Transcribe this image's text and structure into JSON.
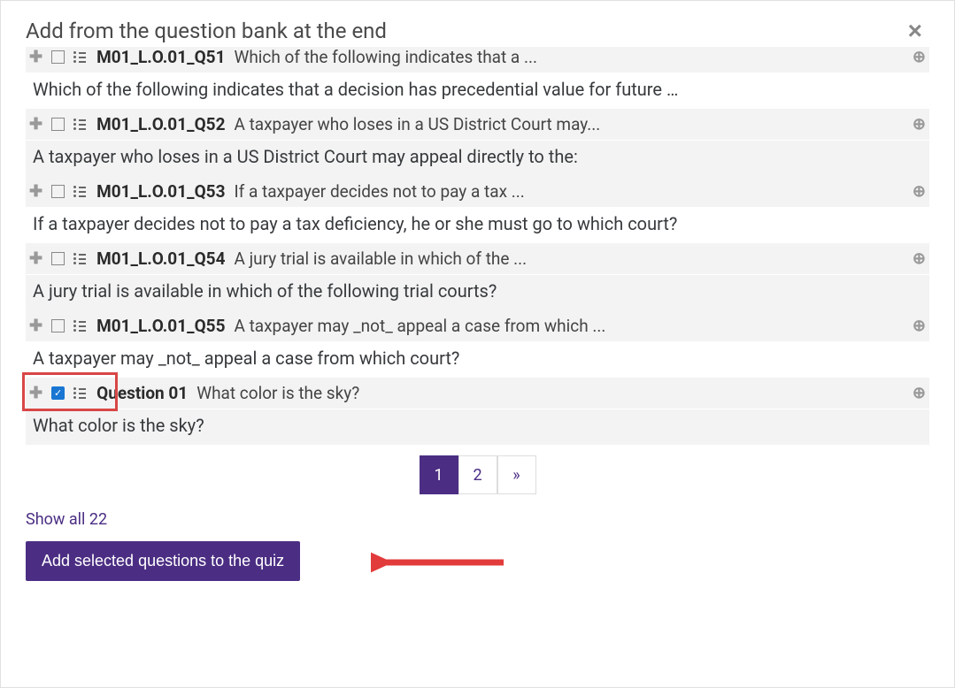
{
  "modal": {
    "title": "Add from the question bank at the end",
    "close_label": "×"
  },
  "questions": [
    {
      "id": "M01_L.O.01_Q51",
      "short": "Which of the following indicates that a ...",
      "full": "Which of the following indicates that a decision has precedential value for future …",
      "checked": false
    },
    {
      "id": "M01_L.O.01_Q52",
      "short": "A taxpayer who loses in a US District Court may...",
      "full": "A taxpayer who loses in a US District Court may appeal directly to the:",
      "checked": false
    },
    {
      "id": "M01_L.O.01_Q53",
      "short": "If a taxpayer decides not to pay a tax ...",
      "full": "If a taxpayer decides not to pay a tax deficiency, he or she must go to which court?",
      "checked": false
    },
    {
      "id": "M01_L.O.01_Q54",
      "short": "A jury trial is available in which of the ...",
      "full": "A jury trial is available in which of the following trial courts?",
      "checked": false
    },
    {
      "id": "M01_L.O.01_Q55",
      "short": "A taxpayer may _not_ appeal a case from which ...",
      "full": "A taxpayer may _not_ appeal a case from which court?",
      "checked": false
    },
    {
      "id": "Question 01",
      "short": "What color is the sky?",
      "full": "What color is the sky?",
      "checked": true
    }
  ],
  "pagination": {
    "pages": [
      "1",
      "2",
      "»"
    ],
    "active": "1"
  },
  "show_all": "Show all 22",
  "add_button": "Add selected questions to the quiz"
}
